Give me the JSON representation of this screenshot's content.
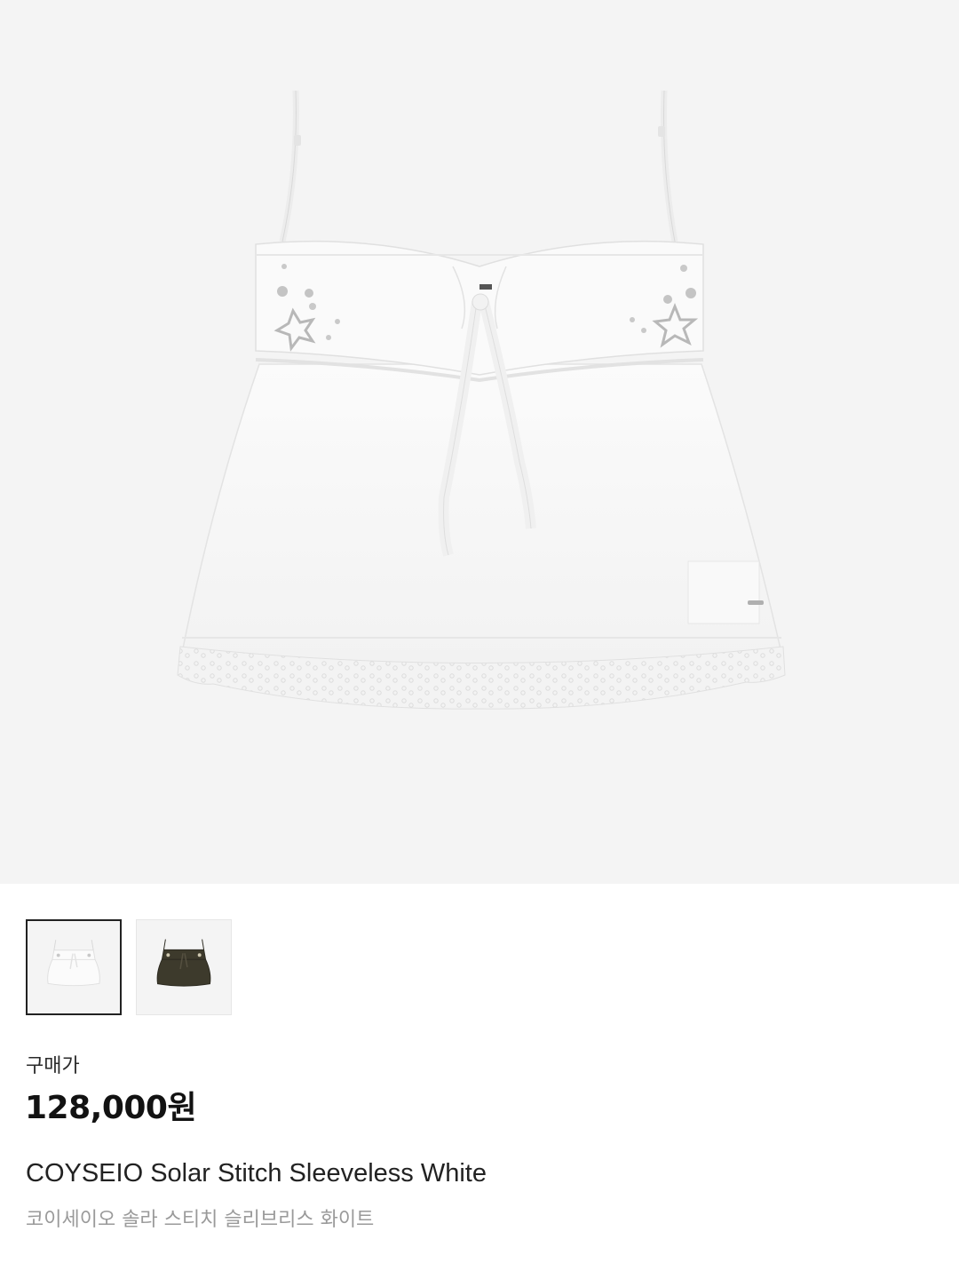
{
  "product": {
    "image_alt": "COYSEIO Solar Stitch Sleeveless White",
    "main_image": "white-sleeveless-top",
    "thumbnails": [
      {
        "name": "white-variant",
        "color": "#f6f6f6",
        "selected": true
      },
      {
        "name": "brown-variant",
        "color": "#3d3a2c",
        "selected": false
      }
    ],
    "price_label": "구매가",
    "price": "128,000원",
    "name_en": "COYSEIO Solar Stitch Sleeveless White",
    "name_ko": "코이세이오 솔라 스티치 슬리브리스 화이트"
  },
  "colors": {
    "hero_bg": "#f4f4f4",
    "price_text": "#121212",
    "subtitle_text": "#9a9a9a"
  }
}
